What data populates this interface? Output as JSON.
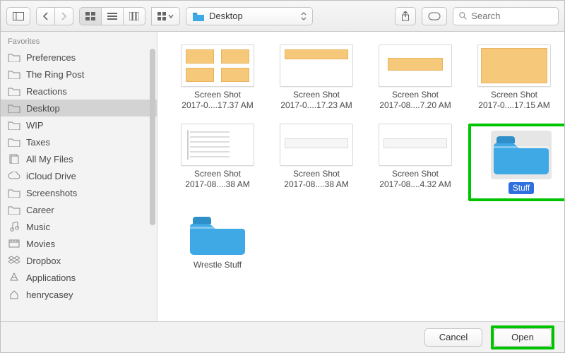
{
  "toolbar": {
    "location_label": "Desktop",
    "search_placeholder": "Search"
  },
  "sidebar": {
    "header": "Favorites",
    "items": [
      {
        "label": "Preferences",
        "icon": "folder",
        "selected": false
      },
      {
        "label": "The Ring Post",
        "icon": "folder",
        "selected": false
      },
      {
        "label": "Reactions",
        "icon": "folder",
        "selected": false
      },
      {
        "label": "Desktop",
        "icon": "folder",
        "selected": true
      },
      {
        "label": "WIP",
        "icon": "folder",
        "selected": false
      },
      {
        "label": "Taxes",
        "icon": "folder",
        "selected": false
      },
      {
        "label": "All My Files",
        "icon": "allfiles",
        "selected": false
      },
      {
        "label": "iCloud Drive",
        "icon": "cloud",
        "selected": false
      },
      {
        "label": "Screenshots",
        "icon": "folder",
        "selected": false
      },
      {
        "label": "Career",
        "icon": "folder",
        "selected": false
      },
      {
        "label": "Music",
        "icon": "music",
        "selected": false
      },
      {
        "label": "Movies",
        "icon": "movies",
        "selected": false
      },
      {
        "label": "Dropbox",
        "icon": "dropbox",
        "selected": false
      },
      {
        "label": "Applications",
        "icon": "apps",
        "selected": false
      },
      {
        "label": "henrycasey",
        "icon": "home",
        "selected": false
      }
    ]
  },
  "files": [
    {
      "kind": "screenshot",
      "l1": "Screen Shot",
      "l2": "2017-0....17.37 AM",
      "thumbStyle": "boxes",
      "selected": false
    },
    {
      "kind": "screenshot",
      "l1": "Screen Shot",
      "l2": "2017-0....17.23 AM",
      "thumbStyle": "topbar",
      "selected": false
    },
    {
      "kind": "screenshot",
      "l1": "Screen Shot",
      "l2": "2017-08....7.20 AM",
      "thumbStyle": "midbar",
      "selected": false
    },
    {
      "kind": "screenshot",
      "l1": "Screen Shot",
      "l2": "2017-0....17.15 AM",
      "thumbStyle": "fill",
      "selected": false
    },
    {
      "kind": "screenshot",
      "l1": "Screen Shot",
      "l2": "2017-08....38 AM",
      "thumbStyle": "textpage",
      "selected": false
    },
    {
      "kind": "screenshot",
      "l1": "Screen Shot",
      "l2": "2017-08....38 AM",
      "thumbStyle": "toolbar",
      "selected": false
    },
    {
      "kind": "screenshot",
      "l1": "Screen Shot",
      "l2": "2017-08....4.32 AM",
      "thumbStyle": "toolbar",
      "selected": false
    },
    {
      "kind": "folder",
      "l1": "Stuff",
      "l2": "",
      "selected": true,
      "highlighted": true
    },
    {
      "kind": "folder",
      "l1": "Wrestle Stuff",
      "l2": "",
      "selected": false
    }
  ],
  "footer": {
    "cancel": "Cancel",
    "open": "Open"
  },
  "colors": {
    "folder_blue": "#3ea9e5",
    "highlight_green": "#00c400"
  }
}
